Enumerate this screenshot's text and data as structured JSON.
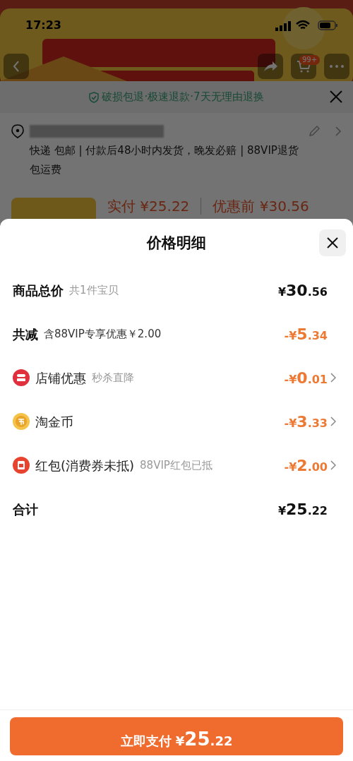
{
  "status_bar": {
    "time": "17:23"
  },
  "banner": {
    "cart_badge": "99+"
  },
  "guarantee": {
    "text": "破损包退·极速退款·7天无理由退换"
  },
  "address": {
    "delivery": "快递 包邮 | 付款后48小时内发货，晚发必赔 | 88VIP退货包运费"
  },
  "product_summary": {
    "paid": "实付 ¥25.22",
    "before": "优惠前 ¥30.56"
  },
  "sheet": {
    "title": "价格明细",
    "rows": [
      {
        "kind": "summary",
        "label": "商品总价",
        "note": "共1件宝贝",
        "amount": "¥30.56",
        "discount": false,
        "link": false
      },
      {
        "kind": "summary",
        "label": "共减",
        "note": "含88VIP专享优惠￥2.00",
        "amount": "-¥5.34",
        "discount": true,
        "link": false
      },
      {
        "kind": "shop",
        "label": "店铺优惠",
        "note": "秒杀直降",
        "amount": "-¥0.01",
        "discount": true,
        "link": true
      },
      {
        "kind": "coin",
        "label": "淘金币",
        "amount": "-¥3.33",
        "discount": true,
        "link": true
      },
      {
        "kind": "redpacket",
        "label": "红包(消费券未抵)",
        "note": "88VIP红包已抵",
        "amount": "-¥2.00",
        "discount": true,
        "link": true
      },
      {
        "kind": "summary",
        "label": "合计",
        "amount": "¥25.22",
        "discount": false,
        "link": false
      }
    ],
    "pay_button": "立即支付 ¥25.22"
  }
}
